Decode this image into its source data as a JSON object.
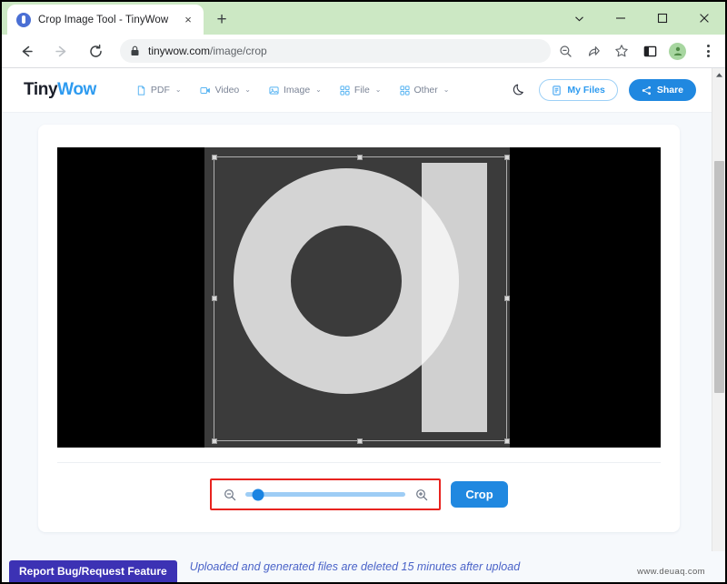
{
  "browser": {
    "tab": {
      "title": "Crop Image Tool - TinyWow",
      "favicon": "tinywow-favicon",
      "close_label": "×"
    },
    "new_tab_label": "+",
    "window_controls": {
      "tab_search": "chevron-down-icon",
      "minimize": "minimize-icon",
      "maximize": "maximize-icon",
      "close": "close-icon"
    },
    "nav": {
      "back": "back-arrow-icon",
      "forward": "forward-arrow-icon",
      "reload": "reload-icon"
    },
    "omnibox": {
      "lock": "lock-icon",
      "host": "tinywow.com",
      "path": "/image/crop",
      "zoom_out_indicator": "zoom-out-icon",
      "share": "share-page-icon",
      "bookmark": "star-icon",
      "side_panel": "side-panel-icon",
      "profile": "profile-avatar",
      "menu": "three-dot-menu-icon"
    }
  },
  "site": {
    "logo": {
      "first": "Tiny",
      "second": "Wow"
    },
    "nav_items": [
      {
        "label": "PDF",
        "icon": "pdf-icon",
        "caret": "⌄"
      },
      {
        "label": "Video",
        "icon": "video-icon",
        "caret": "⌄"
      },
      {
        "label": "Image",
        "icon": "image-icon",
        "caret": "⌄"
      },
      {
        "label": "File",
        "icon": "file-icon",
        "caret": "⌄"
      },
      {
        "label": "Other",
        "icon": "other-icon",
        "caret": "⌄"
      }
    ],
    "dark_mode_icon": "moon-icon",
    "my_files_label": "My Files",
    "my_files_icon": "document-icon",
    "share_label": "Share",
    "share_icon": "share-nodes-icon"
  },
  "editor": {
    "image_alt": "letter-a-graphic",
    "canvas_background": "#000000",
    "artboard_background": "#3b3b3b",
    "shape_color": "#d4d4d4",
    "crop_selection": {
      "handles": [
        "nw",
        "n",
        "ne",
        "w",
        "e",
        "sw",
        "s",
        "se"
      ]
    },
    "zoom_out_icon": "magnifier-minus-icon",
    "zoom_in_icon": "magnifier-plus-icon",
    "slider": {
      "name": "zoom-slider",
      "min": 0,
      "max": 100,
      "value": 8,
      "track_color": "#9ecdf5",
      "thumb_color": "#1a84e2"
    },
    "highlight_color": "#e8231f",
    "crop_button_label": "Crop",
    "crop_button_color": "#2088e0"
  },
  "footer": {
    "report_label": "Report Bug/Request Feature",
    "report_color": "#3c32b4",
    "delete_notice": "Uploaded and generated files are deleted 15 minutes after upload",
    "notice_color": "#4a63c8",
    "watermark": "www.deuaq.com"
  },
  "scrollbar": {
    "up_arrow": "scroll-up-arrow",
    "down_arrow": "scroll-down-arrow"
  }
}
